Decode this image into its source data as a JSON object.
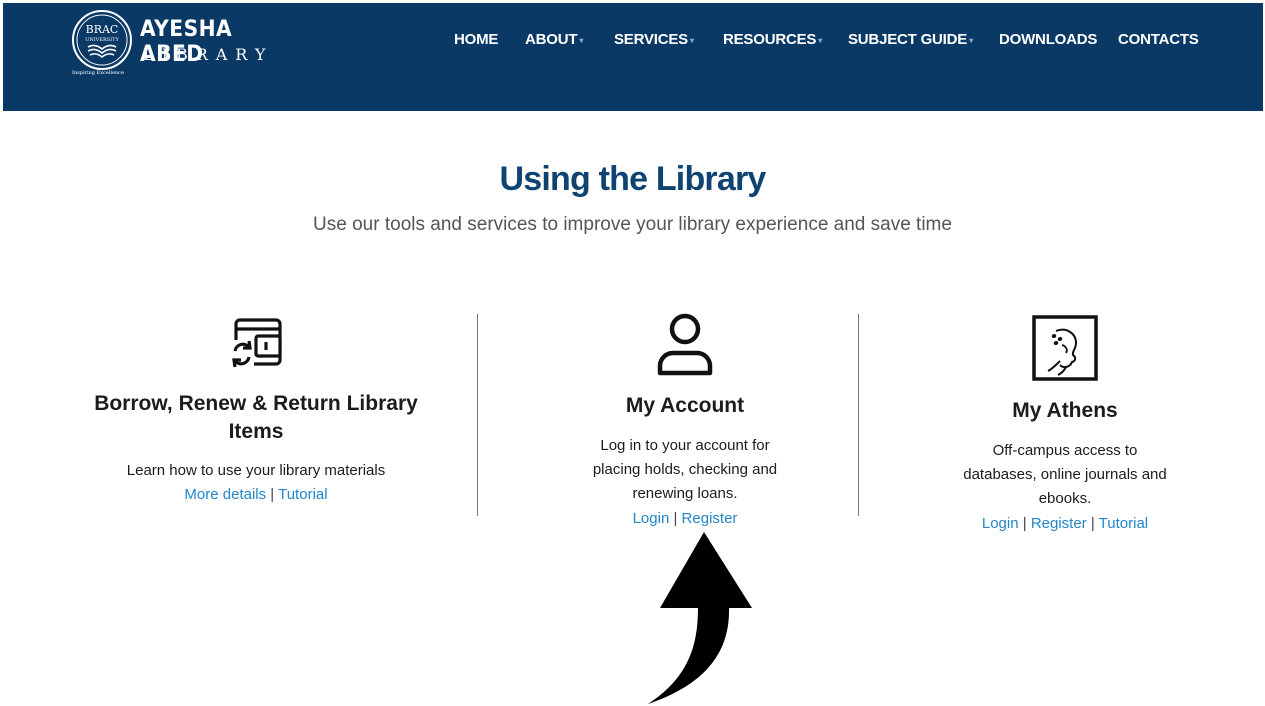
{
  "logo": {
    "university": "BRAC UNIVERSITY",
    "line1": "AYESHA ABED",
    "line2": "LIBRARY",
    "tagline": "Inspiring Excellence"
  },
  "nav": {
    "items": [
      {
        "label": "HOME",
        "has_dropdown": false
      },
      {
        "label": "ABOUT",
        "has_dropdown": true
      },
      {
        "label": "SERVICES",
        "has_dropdown": true
      },
      {
        "label": "RESOURCES",
        "has_dropdown": true
      },
      {
        "label": "SUBJECT GUIDE",
        "has_dropdown": true
      },
      {
        "label": "DOWNLOADS",
        "has_dropdown": false
      },
      {
        "label": "CONTACTS",
        "has_dropdown": false
      }
    ]
  },
  "main": {
    "title": "Using the Library",
    "subtitle": "Use our tools and services to improve your library experience and save time"
  },
  "cards": [
    {
      "icon": "borrow-renew-icon",
      "title": "Borrow, Renew & Return Library Items",
      "text": "Learn how to use your library materials",
      "links": [
        "More details",
        "Tutorial"
      ]
    },
    {
      "icon": "user-account-icon",
      "title": "My Account",
      "text": "Log in to your account for placing holds, checking and renewing loans.",
      "links": [
        "Login",
        "Register"
      ]
    },
    {
      "icon": "athens-logo-icon",
      "title": "My Athens",
      "text": "Off-campus access to databases, online journals and ebooks.",
      "links": [
        "Login",
        "Register",
        "Tutorial"
      ]
    }
  ],
  "colors": {
    "header_bg": "#0b3966",
    "title": "#0f4372",
    "link": "#2286c8"
  }
}
